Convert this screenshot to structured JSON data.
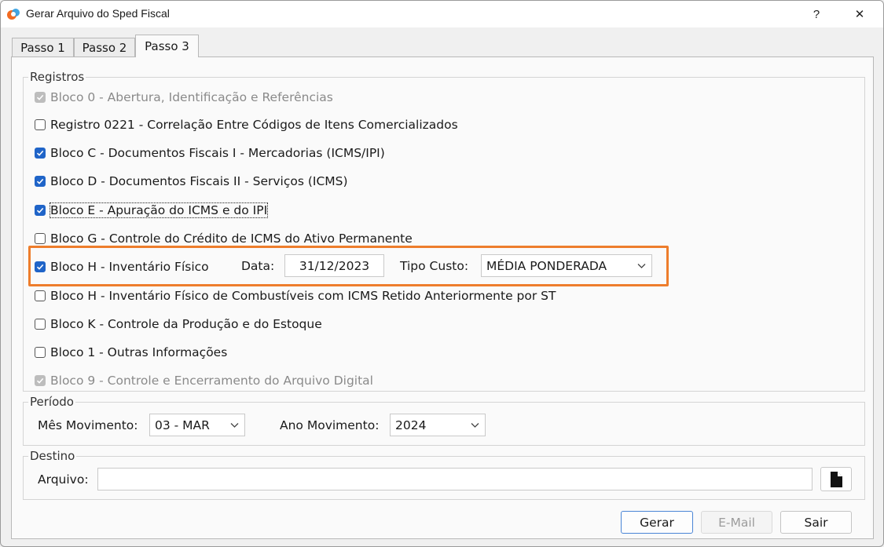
{
  "window": {
    "title": "Gerar Arquivo do Sped Fiscal",
    "help_label": "?",
    "close_label": "✕"
  },
  "tabs": [
    {
      "label": "Passo 1"
    },
    {
      "label": "Passo 2"
    },
    {
      "label": "Passo 3",
      "active": true
    }
  ],
  "registros": {
    "group_label": "Registros",
    "items": [
      {
        "label": "Bloco 0 - Abertura, Identificação e Referências",
        "checked": true,
        "disabled": true
      },
      {
        "label": "Registro 0221 - Correlação Entre Códigos de Itens Comercializados",
        "checked": false,
        "disabled": false
      },
      {
        "label": "Bloco C - Documentos Fiscais I  - Mercadorias (ICMS/IPI)",
        "checked": true,
        "disabled": false
      },
      {
        "label": "Bloco D - Documentos Fiscais II - Serviços (ICMS)",
        "checked": true,
        "disabled": false
      },
      {
        "label": "Bloco E - Apuração do ICMS e do IPI",
        "checked": true,
        "disabled": false,
        "focused": true
      },
      {
        "label": "Bloco G - Controle do Crédito de ICMS do Ativo Permanente",
        "checked": false,
        "disabled": false
      },
      {
        "label": "Bloco H - Inventário Físico",
        "checked": true,
        "disabled": false
      },
      {
        "label": "Bloco H - Inventário Físico de Combustíveis com ICMS Retido Anteriormente por ST",
        "checked": false,
        "disabled": false
      },
      {
        "label": "Bloco K - Controle da Produção e do Estoque",
        "checked": false,
        "disabled": false
      },
      {
        "label": "Bloco 1 - Outras Informações",
        "checked": false,
        "disabled": false
      },
      {
        "label": "Bloco 9 - Controle e Encerramento do Arquivo Digital",
        "checked": true,
        "disabled": true
      }
    ],
    "bloco_h": {
      "data_label": "Data:",
      "data_value": "31/12/2023",
      "tipo_custo_label": "Tipo Custo:",
      "tipo_custo_value": "MÉDIA PONDERADA"
    }
  },
  "periodo": {
    "group_label": "Período",
    "mes_label": "Mês Movimento:",
    "mes_value": "03 - MAR",
    "ano_label": "Ano Movimento:",
    "ano_value": "2024"
  },
  "destino": {
    "group_label": "Destino",
    "arquivo_label": "Arquivo:",
    "arquivo_value": ""
  },
  "buttons": {
    "gerar": "Gerar",
    "email": "E-Mail",
    "sair": "Sair"
  },
  "colors": {
    "accent": "#1f64c8",
    "highlight": "#ee7d2c"
  }
}
